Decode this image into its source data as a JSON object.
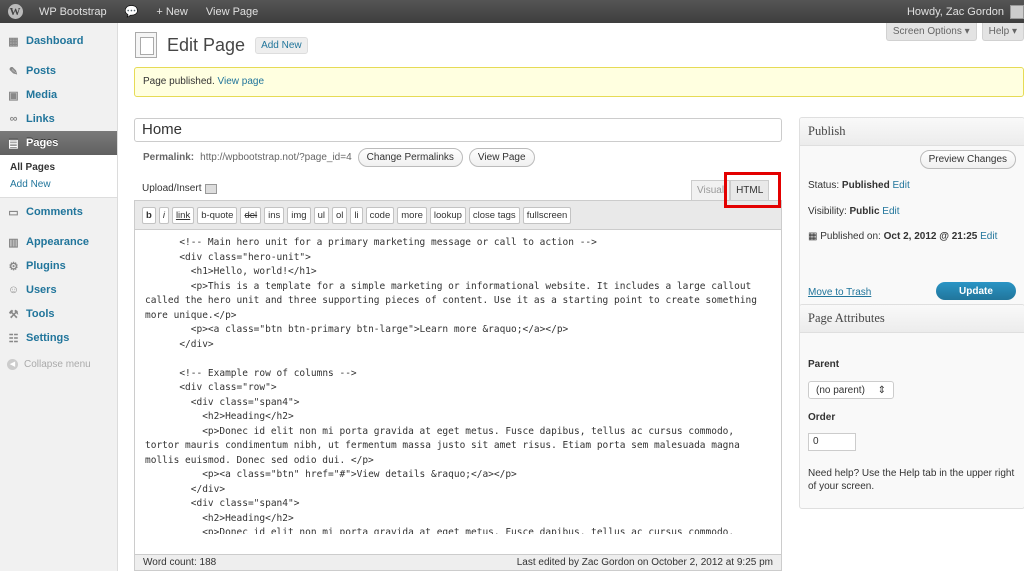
{
  "adminbar": {
    "site_name": "WP Bootstrap",
    "new_label": "+ New",
    "view_page": "View Page",
    "howdy": "Howdy, Zac Gordon"
  },
  "sidebar": {
    "items": [
      {
        "label": "Dashboard",
        "icon": "dashboard-icon"
      },
      {
        "label": "Posts",
        "icon": "posts-icon"
      },
      {
        "label": "Media",
        "icon": "media-icon"
      },
      {
        "label": "Links",
        "icon": "links-icon"
      },
      {
        "label": "Pages",
        "icon": "pages-icon"
      },
      {
        "label": "Comments",
        "icon": "comments-icon"
      },
      {
        "label": "Appearance",
        "icon": "appearance-icon"
      },
      {
        "label": "Plugins",
        "icon": "plugins-icon"
      },
      {
        "label": "Users",
        "icon": "users-icon"
      },
      {
        "label": "Tools",
        "icon": "tools-icon"
      },
      {
        "label": "Settings",
        "icon": "settings-icon"
      }
    ],
    "submenu": [
      "All Pages",
      "Add New"
    ],
    "collapse": "Collapse menu"
  },
  "header": {
    "title": "Edit Page",
    "add_new": "Add New",
    "screen_options": "Screen Options ▾",
    "help": "Help ▾"
  },
  "notice": {
    "text": "Page published.",
    "link": "View page"
  },
  "post": {
    "title": "Home",
    "permalink_label": "Permalink:",
    "permalink_url": "http://wpbootstrap.not/?page_id=4",
    "change_permalinks": "Change Permalinks",
    "view_page": "View Page"
  },
  "editor": {
    "upload_insert": "Upload/Insert",
    "tab_visual": "Visual",
    "tab_html": "HTML",
    "quicktags": [
      "b",
      "i",
      "link",
      "b-quote",
      "del",
      "ins",
      "img",
      "ul",
      "ol",
      "li",
      "code",
      "more",
      "lookup",
      "close tags",
      "fullscreen"
    ],
    "content": "      <!-- Main hero unit for a primary marketing message or call to action -->\n      <div class=\"hero-unit\">\n        <h1>Hello, world!</h1>\n        <p>This is a template for a simple marketing or informational website. It includes a large callout called the hero unit and three supporting pieces of content. Use it as a starting point to create something more unique.</p>\n        <p><a class=\"btn btn-primary btn-large\">Learn more &raquo;</a></p>\n      </div>\n\n      <!-- Example row of columns -->\n      <div class=\"row\">\n        <div class=\"span4\">\n          <h2>Heading</h2>\n          <p>Donec id elit non mi porta gravida at eget metus. Fusce dapibus, tellus ac cursus commodo, tortor mauris condimentum nibh, ut fermentum massa justo sit amet risus. Etiam porta sem malesuada magna mollis euismod. Donec sed odio dui. </p>\n          <p><a class=\"btn\" href=\"#\">View details &raquo;</a></p>\n        </div>\n        <div class=\"span4\">\n          <h2>Heading</h2>\n          <p>Donec id elit non mi porta gravida at eget metus. Fusce dapibus, tellus ac cursus commodo, tortor",
    "word_count": "Word count: 188",
    "last_edited": "Last edited by Zac Gordon on October 2, 2012 at 9:25 pm"
  },
  "publish": {
    "title": "Publish",
    "preview": "Preview Changes",
    "status_label": "Status:",
    "status_value": "Published",
    "visibility_label": "Visibility:",
    "visibility_value": "Public",
    "published_label": "Published on:",
    "published_value": "Oct 2, 2012 @ 21:25",
    "edit": "Edit",
    "trash": "Move to Trash",
    "update": "Update"
  },
  "attributes": {
    "title": "Page Attributes",
    "parent_label": "Parent",
    "parent_value": "(no parent)",
    "order_label": "Order",
    "order_value": "0",
    "help": "Need help? Use the Help tab in the upper right of your screen."
  }
}
